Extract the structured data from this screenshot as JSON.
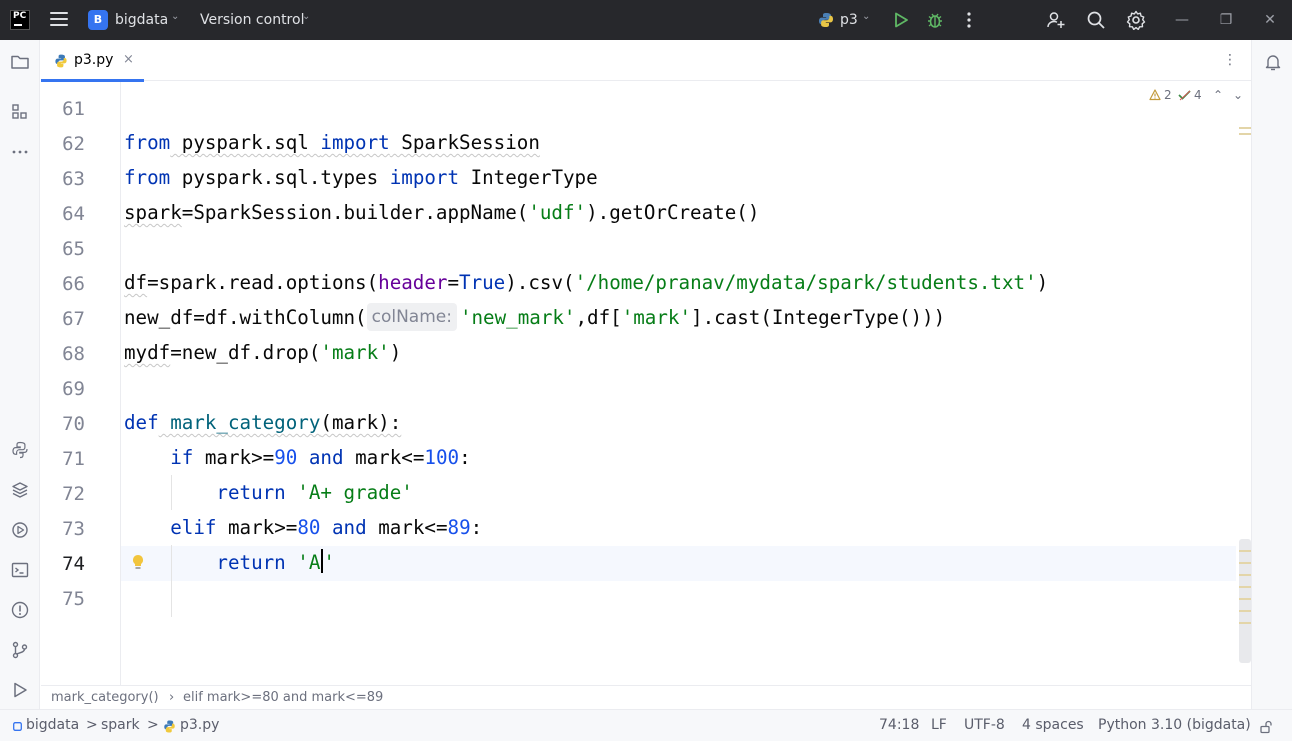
{
  "titlebar": {
    "logo": "PC",
    "project_badge": "B",
    "project_name": "bigdata",
    "vcs_label": "Version control",
    "run_config": "p3"
  },
  "tab": {
    "file_name": "p3.py",
    "close": "×",
    "more": "⋮"
  },
  "inspections": {
    "warnings": "2",
    "ok": "4"
  },
  "line_numbers": [
    "61",
    "62",
    "63",
    "64",
    "65",
    "66",
    "67",
    "68",
    "69",
    "70",
    "71",
    "72",
    "73",
    "74",
    "75"
  ],
  "current_line": "74",
  "code": {
    "l62": {
      "kw1": "from",
      "mod": " pyspark.sql ",
      "kw2": "import",
      "name": " SparkSession"
    },
    "l63": {
      "kw1": "from",
      "mod": " pyspark.sql.types ",
      "kw2": "import",
      "name": " IntegerType"
    },
    "l64": {
      "var": "spark",
      "rest": "=SparkSession.builder.appName(",
      "str": "'udf'",
      "end": ").getOrCreate()"
    },
    "l66": {
      "var": "df",
      "a": "=spark.read.options(",
      "param": "header",
      "eq": "=",
      "kw": "True",
      "b": ").csv(",
      "str": "'/home/pranav/mydata/spark/students.txt'",
      "end": ")"
    },
    "l67": {
      "a": "new_df=df.withColumn(",
      "hint": "colName:",
      "str1": "'new_mark'",
      "b": ",df[",
      "str2": "'mark'",
      "end": "].cast(IntegerType()))"
    },
    "l68": {
      "var": "mydf",
      "a": "=new_df.drop(",
      "str": "'mark'",
      "end": ")"
    },
    "l70": {
      "kw": "def",
      "fn": " mark_category",
      "rest": "(mark):"
    },
    "l71": {
      "indent": "    ",
      "kw1": "if",
      "a": " mark>=",
      "n1": "90",
      "sp": " ",
      "kw2": "and",
      "b": " mark<=",
      "n2": "100",
      "end": ":"
    },
    "l72": {
      "indent": "        ",
      "kw": "return",
      "sp": " ",
      "str": "'A+ grade'"
    },
    "l73": {
      "indent": "    ",
      "kw1": "elif",
      "a": " mark>=",
      "n1": "80",
      "sp": " ",
      "kw2": "and",
      "b": " mark<=",
      "n2": "89",
      "end": ":"
    },
    "l74": {
      "indent": "        ",
      "kw": "return",
      "sp": " ",
      "str1": "'A",
      "str2": "'"
    }
  },
  "breadcrumb": {
    "item1": "mark_category()",
    "sep": "›",
    "item2": "elif mark>=80 and mark<=89"
  },
  "status": {
    "path1": "bigdata",
    "path2": "spark",
    "path3": "p3.py",
    "sep": ">",
    "position": "74:18",
    "line_sep": "LF",
    "encoding": "UTF-8",
    "indent": "4 spaces",
    "interpreter": "Python 3.10 (bigdata)"
  },
  "colors": {
    "keyword": "#0033b3",
    "string": "#067d17",
    "number": "#1750eb",
    "function": "#00627a",
    "accent": "#3574f0"
  }
}
